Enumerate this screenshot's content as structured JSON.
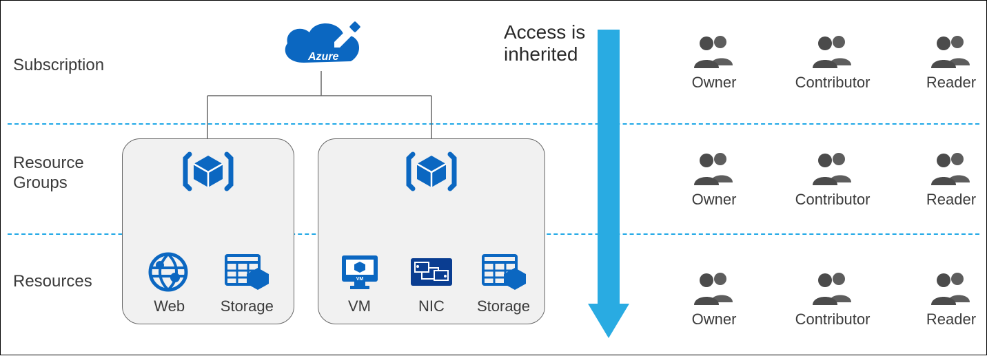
{
  "header": {
    "accessText": "Access is\ninherited",
    "azureBrand": "Azure"
  },
  "levels": {
    "subscription": {
      "label": "Subscription"
    },
    "resourceGroups": {
      "label": "Resource\nGroups"
    },
    "resources": {
      "label": "Resources"
    }
  },
  "resourceGroups": [
    {
      "resources": [
        {
          "label": "Web",
          "icon": "web-icon"
        },
        {
          "label": "Storage",
          "icon": "storage-icon"
        }
      ]
    },
    {
      "resources": [
        {
          "label": "VM",
          "icon": "vm-icon"
        },
        {
          "label": "NIC",
          "icon": "nic-icon"
        },
        {
          "label": "Storage",
          "icon": "storage-icon"
        }
      ]
    }
  ],
  "roles": {
    "owner": "Owner",
    "contributor": "Contributor",
    "reader": "Reader"
  },
  "roleRows": [
    [
      "owner",
      "contributor",
      "reader"
    ],
    [
      "owner",
      "contributor",
      "reader"
    ],
    [
      "owner",
      "contributor",
      "reader"
    ]
  ],
  "colors": {
    "azure": "#0b67c1",
    "accent": "#29abe2",
    "gray": "#4b4b4b"
  }
}
